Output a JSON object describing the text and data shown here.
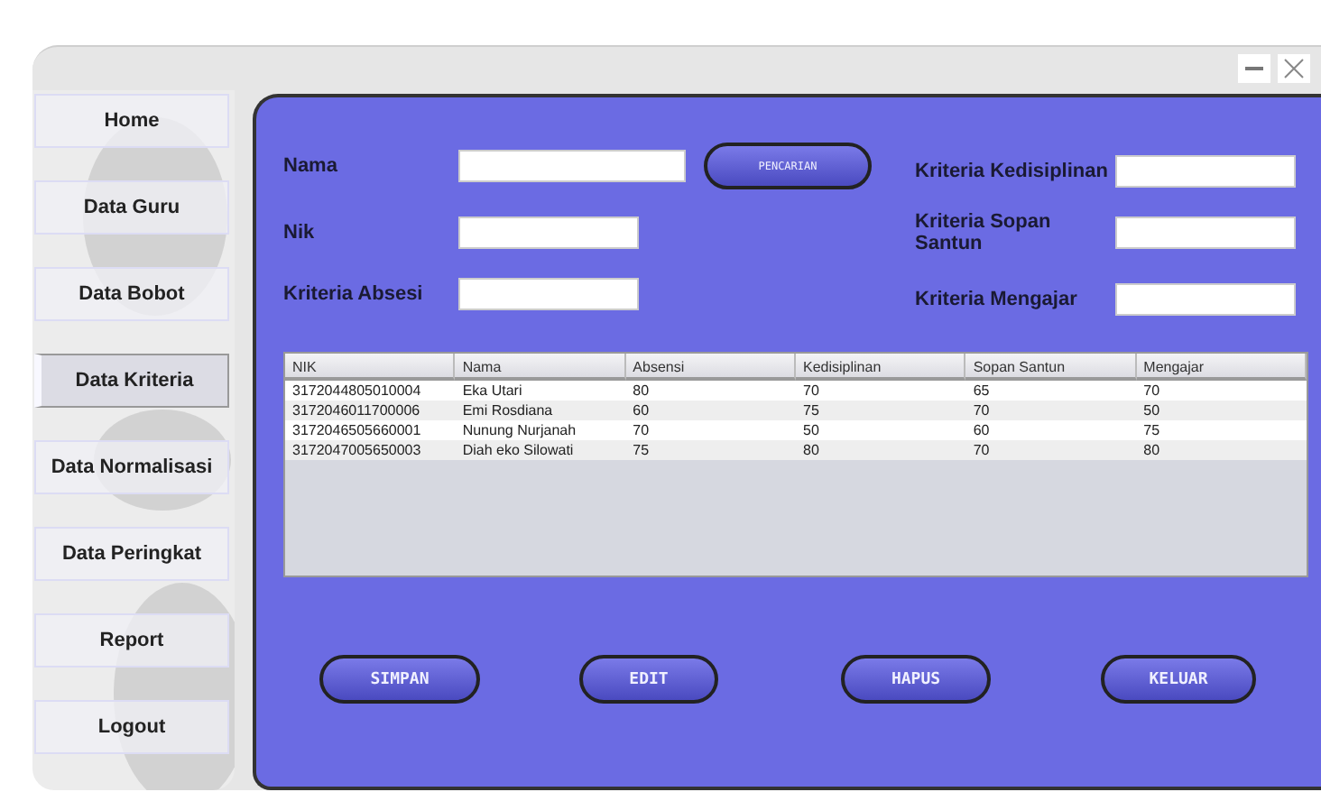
{
  "sidebar": {
    "items": [
      {
        "label": "Home",
        "selected": false
      },
      {
        "label": "Data Guru",
        "selected": false
      },
      {
        "label": "Data Bobot",
        "selected": false
      },
      {
        "label": "Data Kriteria",
        "selected": true
      },
      {
        "label": "Data Normalisasi",
        "selected": false
      },
      {
        "label": "Data Peringkat",
        "selected": false
      },
      {
        "label": "Report",
        "selected": false
      },
      {
        "label": "Logout",
        "selected": false
      }
    ]
  },
  "form": {
    "left": [
      {
        "label": "Nama"
      },
      {
        "label": "Nik"
      },
      {
        "label": "Kriteria Absesi"
      }
    ],
    "search_button": "PENCARIAN",
    "right": [
      {
        "label": "Kriteria Kedisiplinan"
      },
      {
        "label": "Kriteria Sopan Santun"
      },
      {
        "label": "Kriteria Mengajar"
      }
    ]
  },
  "table": {
    "columns": [
      "NIK",
      "Nama",
      "Absensi",
      "Kedisiplinan",
      "Sopan Santun",
      "Mengajar"
    ],
    "rows": [
      [
        "3172044805010004",
        "Eka Utari",
        "80",
        "70",
        "65",
        "70"
      ],
      [
        "3172046011700006",
        "Emi Rosdiana",
        "60",
        "75",
        "70",
        "50"
      ],
      [
        "3172046505660001",
        "Nunung Nurjanah",
        "70",
        "50",
        "60",
        "75"
      ],
      [
        "3172047005650003",
        "Diah eko Silowati",
        "75",
        "80",
        "70",
        "80"
      ]
    ]
  },
  "buttons": [
    "SIMPAN",
    "EDIT",
    "HAPUS",
    "KELUAR"
  ]
}
